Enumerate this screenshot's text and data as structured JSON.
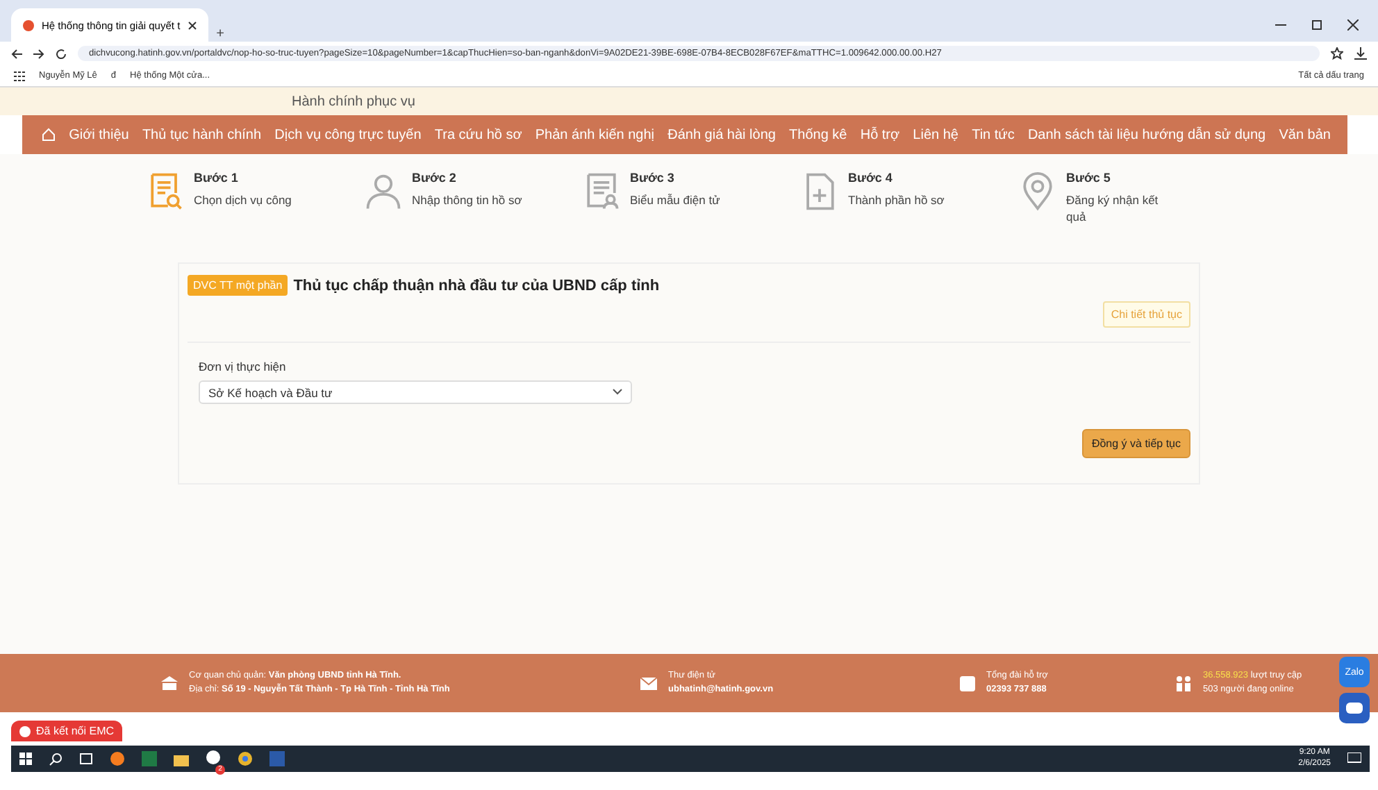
{
  "browser": {
    "tab_title": "Hệ thống thông tin giải quyết t",
    "new_tab": "+",
    "url": "dichvucong.hatinh.gov.vn/portaldvc/nop-ho-so-truc-tuyen?pageSize=10&pageNumber=1&capThucHien=so-ban-nganh&donVi=9A02DE21-39BE-698E-07B4-8ECB028F67EF&maTTHC=1.009642.000.00.00.H27",
    "bookmarks": [
      "Nguyễn Mỹ Lê",
      "đ",
      "Hệ thống Một cửa..."
    ],
    "all_bookmarks": "Tất cả dấu trang"
  },
  "header": {
    "subtitle": "Hành chính phục vụ"
  },
  "nav": [
    {
      "label": "Giới thiệu"
    },
    {
      "label": "Thủ tục hành chính"
    },
    {
      "label": "Dịch vụ công trực tuyến"
    },
    {
      "label": "Tra cứu hồ sơ"
    },
    {
      "label": "Phản ánh kiến nghị"
    },
    {
      "label": "Đánh giá hài lòng"
    },
    {
      "label": "Thống kê"
    },
    {
      "label": "Hỗ trợ"
    },
    {
      "label": "Liên hệ"
    },
    {
      "label": "Tin tức"
    },
    {
      "label": "Danh sách tài liệu hướng dẫn sử dụng"
    },
    {
      "label": "Văn bản"
    }
  ],
  "steps": [
    {
      "kind": "search-doc",
      "title": "Bước 1",
      "text": "Chọn dịch vụ công",
      "selected": true
    },
    {
      "kind": "person",
      "title": "Bước 2",
      "text": "Nhập thông tin hồ sơ",
      "selected": false
    },
    {
      "kind": "form",
      "title": "Bước 3",
      "text": "Biểu mẫu điện tử",
      "selected": false
    },
    {
      "kind": "file-plus",
      "title": "Bước 4",
      "text": "Thành phần hồ sơ",
      "selected": false
    },
    {
      "kind": "pin",
      "title": "Bước 5",
      "text": "Đăng ký nhận kết quả",
      "selected": false
    }
  ],
  "procedure": {
    "badge": "DVC TT một phần",
    "title": "Thủ tục chấp thuận nhà đầu tư của UBND cấp tỉnh",
    "details_button": "Chi tiết thủ tục",
    "field_label": "Đơn vị thực hiện",
    "field_value": "Sở Kế hoạch và Đầu tư",
    "submit_button": "Đồng ý và tiếp tục"
  },
  "footer": {
    "agency_label": "Cơ quan chủ quản:",
    "agency": "Văn phòng UBND tỉnh Hà Tĩnh.",
    "address_label": "Địa chỉ:",
    "address": "Số 19 - Nguyễn Tất Thành - Tp Hà Tĩnh - Tỉnh Hà Tĩnh",
    "email_label": "Thư điện tử",
    "email": "ubhatinh@hatinh.gov.vn",
    "hotline_label": "Tổng đài hỗ trợ",
    "hotline": "02393 737 888",
    "visits": "36.558.923",
    "visits_label": "lượt truy cập",
    "online": "503 người đang online"
  },
  "zalo": "Zalo",
  "emc": "Đã kết nối EMC",
  "taskbar": {
    "time": "9:20 AM",
    "date": "2/6/2025",
    "badge": "2"
  }
}
